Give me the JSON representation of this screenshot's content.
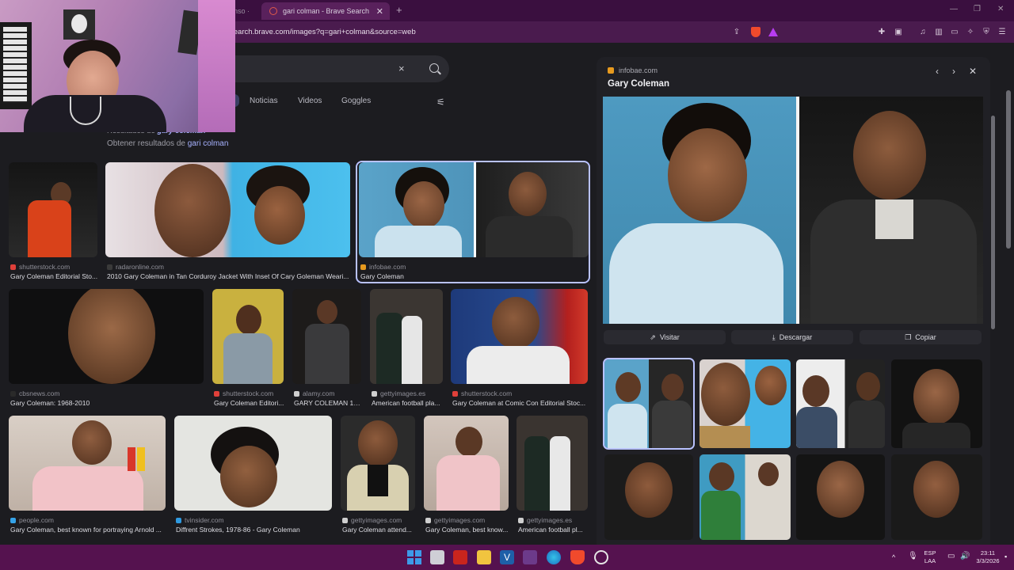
{
  "browser": {
    "tabs": [
      {
        "label": "enso ·",
        "active": false
      },
      {
        "label": "gari colman - Brave Search",
        "active": true
      }
    ],
    "url": "search.brave.com/images?q=gari+colman&source=web"
  },
  "search": {
    "clear_label": "×",
    "filters": [
      "Noticias",
      "Videos",
      "Goggles"
    ],
    "results_for_prefix": "Resultados de",
    "results_for_query": "gary coleman",
    "obtain_prefix": "Obtener resultados de",
    "obtain_query": "gari colman"
  },
  "grid": {
    "row1": [
      {
        "source": "shutterstock.com",
        "caption": "Gary Coleman Editorial Sto...",
        "src_color": "#e0403a"
      },
      {
        "source": "radaronline.com",
        "caption": "2010 Gary Coleman in Tan Corduroy Jacket With Inset Of Cary Goleman Weari...",
        "src_color": "#3a3a3a"
      },
      {
        "source": "infobae.com",
        "caption": "Gary Coleman",
        "src_color": "#e79a1e"
      }
    ],
    "row2": [
      {
        "source": "cbsnews.com",
        "caption": "Gary Coleman: 1968-2010",
        "src_color": "#2a2a2a"
      },
      {
        "source": "shutterstock.com",
        "caption": "Gary Coleman Editori...",
        "src_color": "#e0403a"
      },
      {
        "source": "alamy.com",
        "caption": "GARY COLEMAN 19...",
        "src_color": "#cfcfcf"
      },
      {
        "source": "gettyimages.es",
        "caption": "American football pla...",
        "src_color": "#cfcfcf"
      },
      {
        "source": "shutterstock.com",
        "caption": "Gary Coleman at Comic Con Editorial Stoc...",
        "src_color": "#e0403a"
      }
    ],
    "row3": [
      {
        "source": "people.com",
        "caption": "Gary Coleman, best known for portraying Arnold ...",
        "src_color": "#35a3e8"
      },
      {
        "source": "tvinsider.com",
        "caption": "Diffrent Strokes, 1978-86 - Gary Coleman",
        "src_color": "#2f9ae0"
      },
      {
        "source": "gettyimages.com",
        "caption": "Gary Coleman attend...",
        "src_color": "#cfcfcf"
      },
      {
        "source": "gettyimages.com",
        "caption": "Gary Coleman, best know...",
        "src_color": "#cfcfcf"
      },
      {
        "source": "gettyimages.es",
        "caption": "American football pl...",
        "src_color": "#cfcfcf"
      }
    ]
  },
  "panel": {
    "source": "infobae.com",
    "title": "Gary Coleman",
    "visit_label": "Visitar",
    "download_label": "Descargar",
    "copy_label": "Copiar"
  },
  "taskbar": {
    "lang_line1": "ESP",
    "lang_line2": "LAA",
    "time": "23:11",
    "date": "3/3/2026"
  }
}
